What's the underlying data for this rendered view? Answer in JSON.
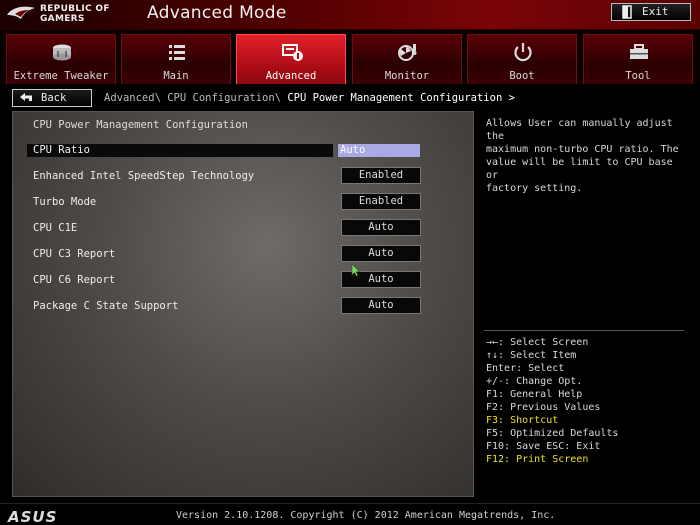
{
  "header": {
    "logo_text_line1": "REPUBLIC OF",
    "logo_text_line2": "GAMERS",
    "title": "Advanced Mode",
    "exit_label": "Exit"
  },
  "tabs": [
    {
      "label": "Extreme Tweaker",
      "icon": "gauge-icon",
      "active": false
    },
    {
      "label": "Main",
      "icon": "list-icon",
      "active": false
    },
    {
      "label": "Advanced",
      "icon": "advanced-settings-icon",
      "active": true
    },
    {
      "label": "Monitor",
      "icon": "monitor-fan-icon",
      "active": false
    },
    {
      "label": "Boot",
      "icon": "power-icon",
      "active": false
    },
    {
      "label": "Tool",
      "icon": "toolbox-icon",
      "active": false
    }
  ],
  "nav": {
    "back_label": "Back",
    "breadcrumb_path": "Advanced\\ CPU Configuration\\ ",
    "breadcrumb_current": "CPU Power Management Configuration >"
  },
  "main": {
    "section_title": "CPU Power Management Configuration",
    "settings": [
      {
        "label": "CPU Ratio",
        "value": "Auto",
        "selected": true
      },
      {
        "label": "Enhanced Intel SpeedStep Technology",
        "value": "Enabled"
      },
      {
        "label": "Turbo Mode",
        "value": "Enabled"
      },
      {
        "label": "CPU C1E",
        "value": "Auto"
      },
      {
        "label": "CPU C3 Report",
        "value": "Auto"
      },
      {
        "label": "CPU C6 Report",
        "value": "Auto"
      },
      {
        "label": "Package C State Support",
        "value": "Auto"
      }
    ]
  },
  "help": {
    "description": "Allows User can manually adjust the\nmaximum non-turbo CPU ratio. The\nvalue will be limit to CPU base or\nfactory setting.",
    "keys": [
      {
        "text": "→←: Select Screen",
        "highlight": false
      },
      {
        "text": "↑↓: Select Item",
        "highlight": false
      },
      {
        "text": "Enter: Select",
        "highlight": false
      },
      {
        "text": "+/-: Change Opt.",
        "highlight": false
      },
      {
        "text": "F1: General Help",
        "highlight": false
      },
      {
        "text": "F2: Previous Values",
        "highlight": false
      },
      {
        "text": "F3: Shortcut",
        "highlight": true
      },
      {
        "text": "F5: Optimized Defaults",
        "highlight": false
      },
      {
        "text": "F10: Save  ESC: Exit",
        "highlight": false
      },
      {
        "text": "F12: Print Screen",
        "highlight": true
      }
    ]
  },
  "footer": {
    "brand": "ASUS",
    "version": "Version 2.10.1208. Copyright (C) 2012 American Megatrends, Inc."
  },
  "colors": {
    "accent": "#c4101c",
    "highlight_key": "#f0e020",
    "selected_value_bg": "#a9a9e6"
  }
}
